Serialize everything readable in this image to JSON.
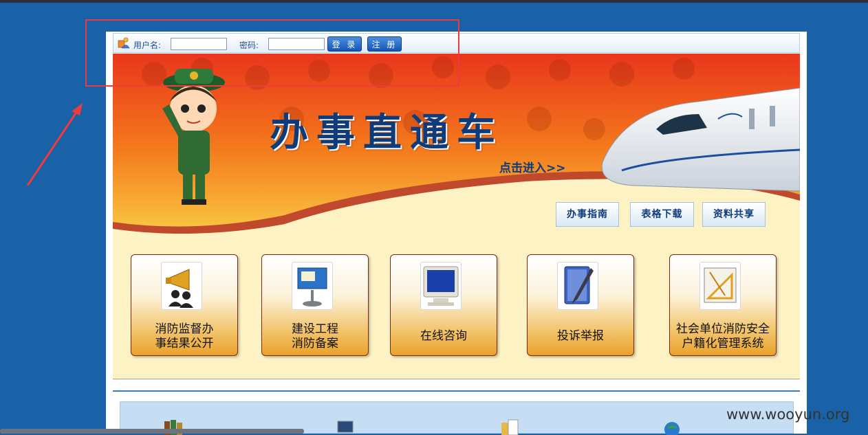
{
  "login": {
    "username_label": "用户名:",
    "password_label": "密码:",
    "login_button": "登 录",
    "register_button": "注 册",
    "username_value": "",
    "password_value": ""
  },
  "banner": {
    "title": "办事直通车",
    "enter_link": "点击进入>>",
    "quick_links": [
      "办事指南",
      "表格下载",
      "资料共享"
    ]
  },
  "tiles": [
    {
      "line1": "消防监督办",
      "line2": "事结果公开",
      "icon": "megaphone-icon"
    },
    {
      "line1": "建设工程",
      "line2": "消防备案",
      "icon": "keynote-icon"
    },
    {
      "line1": "在线咨询",
      "line2": "",
      "icon": "monitor-icon"
    },
    {
      "line1": "投诉举报",
      "line2": "",
      "icon": "notebook-pen-icon"
    },
    {
      "line1": "社会单位消防安全",
      "line2": "户籍化管理系统",
      "icon": "drafting-icon"
    }
  ],
  "watermark": "www.wooyun.org",
  "colors": {
    "background": "#1a62a8",
    "accent_blue": "#0e3c7a",
    "annotation": "#ef3b3b"
  }
}
